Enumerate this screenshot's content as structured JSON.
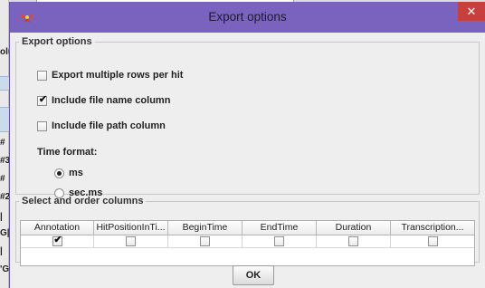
{
  "background": {
    "fragments": [
      "olu",
      "#",
      "#3",
      "#",
      "#2",
      "|",
      "G|",
      "|",
      "'G"
    ]
  },
  "dialog": {
    "title": "Export options",
    "close_glyph": "✕",
    "icon": "app-logo-icon",
    "titlebar_color": "#7a63bf"
  },
  "export_options": {
    "legend": "Export options",
    "multiple_rows": {
      "label": "Export multiple rows per hit",
      "checked": false
    },
    "include_file_name": {
      "label": "Include file name column",
      "checked": true
    },
    "include_file_path": {
      "label": "Include file path column",
      "checked": false
    },
    "time_format": {
      "label": "Time format:",
      "options": [
        {
          "label": "ms",
          "selected": true
        },
        {
          "label": "sec.ms",
          "selected": false
        }
      ]
    }
  },
  "columns": {
    "legend": "Select and order columns",
    "headers": [
      "Annotation",
      "HitPositionInTi...",
      "BeginTime",
      "EndTime",
      "Duration",
      "Transcription..."
    ],
    "checked": [
      true,
      false,
      false,
      false,
      false,
      false
    ]
  },
  "ok_label": "OK"
}
